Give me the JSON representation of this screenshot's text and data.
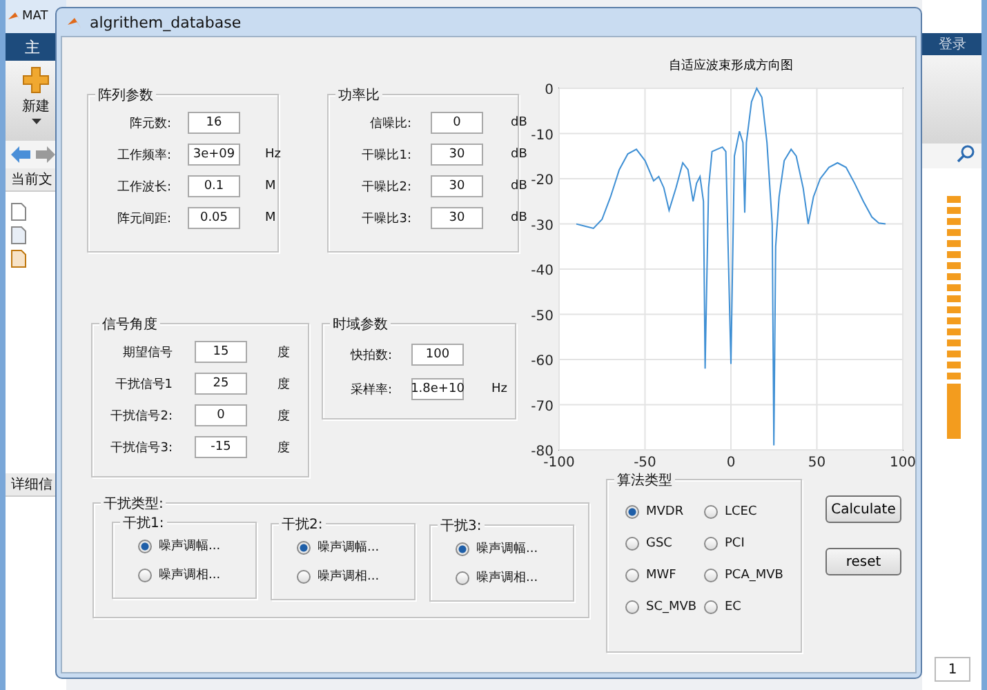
{
  "desktop": {
    "title": "MAT",
    "tab": "主",
    "new_button": "新建",
    "folder_header": "当前文",
    "details_header": "详细信",
    "signin": "登录",
    "page_field": "1"
  },
  "window": {
    "title": "algrithem_database"
  },
  "array_params": {
    "title": "阵列参数",
    "fields": [
      {
        "label": "阵元数:",
        "value": "16"
      },
      {
        "label": "工作频率:",
        "value": "3e+09",
        "unit": "Hz"
      },
      {
        "label": "工作波长:",
        "value": "0.1",
        "unit": "M"
      },
      {
        "label": "阵元间距:",
        "value": "0.05",
        "unit": "M"
      }
    ]
  },
  "power_ratio": {
    "title": "功率比",
    "fields": [
      {
        "label": "信噪比:",
        "value": "0",
        "unit": "dB"
      },
      {
        "label": "干噪比1:",
        "value": "30",
        "unit": "dB"
      },
      {
        "label": "干噪比2:",
        "value": "30",
        "unit": "dB"
      },
      {
        "label": "干噪比3:",
        "value": "30",
        "unit": "dB"
      }
    ]
  },
  "signal_angle": {
    "title": "信号角度",
    "fields": [
      {
        "label": "期望信号",
        "value": "15",
        "unit": "度"
      },
      {
        "label": "干扰信号1",
        "value": "25",
        "unit": "度"
      },
      {
        "label": "干扰信号2:",
        "value": "0",
        "unit": "度"
      },
      {
        "label": "干扰信号3:",
        "value": "-15",
        "unit": "度"
      }
    ]
  },
  "time_params": {
    "title": "时域参数",
    "fields": [
      {
        "label": "快拍数:",
        "value": "100"
      },
      {
        "label": "采样率:",
        "value": "1.8e+10",
        "unit": "Hz"
      }
    ]
  },
  "interference_type": {
    "title": "干扰类型:",
    "groups": [
      {
        "title": "干扰1:",
        "options": [
          {
            "label": "噪声调幅...",
            "selected": true
          },
          {
            "label": "噪声调相...",
            "selected": false
          }
        ]
      },
      {
        "title": "干扰2:",
        "options": [
          {
            "label": "噪声调幅...",
            "selected": true
          },
          {
            "label": "噪声调相...",
            "selected": false
          }
        ]
      },
      {
        "title": "干扰3:",
        "options": [
          {
            "label": "噪声调幅...",
            "selected": true
          },
          {
            "label": "噪声调相...",
            "selected": false
          }
        ]
      }
    ]
  },
  "algorithm": {
    "title": "算法类型",
    "options": [
      {
        "label": "MVDR",
        "selected": true
      },
      {
        "label": "LCEC",
        "selected": false
      },
      {
        "label": "GSC",
        "selected": false
      },
      {
        "label": "PCI",
        "selected": false
      },
      {
        "label": "MWF",
        "selected": false
      },
      {
        "label": "PCA_MVB",
        "selected": false
      },
      {
        "label": "SC_MVB",
        "selected": false
      },
      {
        "label": "EC",
        "selected": false
      }
    ]
  },
  "buttons": [
    "Calculate",
    "reset"
  ],
  "plot": {
    "chart_data": {
      "type": "line",
      "title": "自适应波束形成方向图",
      "x": [
        -90,
        -85,
        -80,
        -75,
        -70,
        -65,
        -60,
        -55,
        -50,
        -45,
        -42,
        -39,
        -36,
        -32,
        -28,
        -25,
        -22,
        -20,
        -18,
        -16,
        -15,
        -13,
        -11,
        -8,
        -5,
        -3,
        0,
        2,
        5,
        7,
        8,
        9,
        12,
        15,
        18,
        21,
        24,
        25,
        26,
        28,
        31,
        35,
        38,
        42,
        45,
        48,
        52,
        57,
        62,
        67,
        72,
        77,
        82,
        86,
        90
      ],
      "grid": true,
      "series": [
        {
          "color": "#3e8fd4",
          "values": [
            -30,
            -30.5,
            -31,
            -29,
            -24,
            -18,
            -14.5,
            -13.5,
            -16,
            -20.5,
            -19.5,
            -22,
            -27,
            -22,
            -16.5,
            -18,
            -25,
            -21,
            -19.5,
            -25,
            -62,
            -22,
            -14,
            -13.5,
            -13,
            -14,
            -61,
            -15,
            -9.5,
            -12,
            -27.5,
            -12,
            -3,
            0,
            -2,
            -12,
            -30,
            -79,
            -35,
            -24,
            -16,
            -13.5,
            -15,
            -22,
            -30,
            -24,
            -20,
            -17.5,
            -16.5,
            -17.5,
            -21,
            -25,
            -28.5,
            -29.8,
            -30
          ]
        }
      ],
      "xlim": [
        -100,
        100
      ],
      "ylim": [
        -80,
        0
      ],
      "xticks": [
        -100,
        -50,
        0,
        50,
        100
      ],
      "yticks": [
        -80,
        -70,
        -60,
        -50,
        -40,
        -30,
        -20,
        -10,
        0
      ]
    }
  }
}
